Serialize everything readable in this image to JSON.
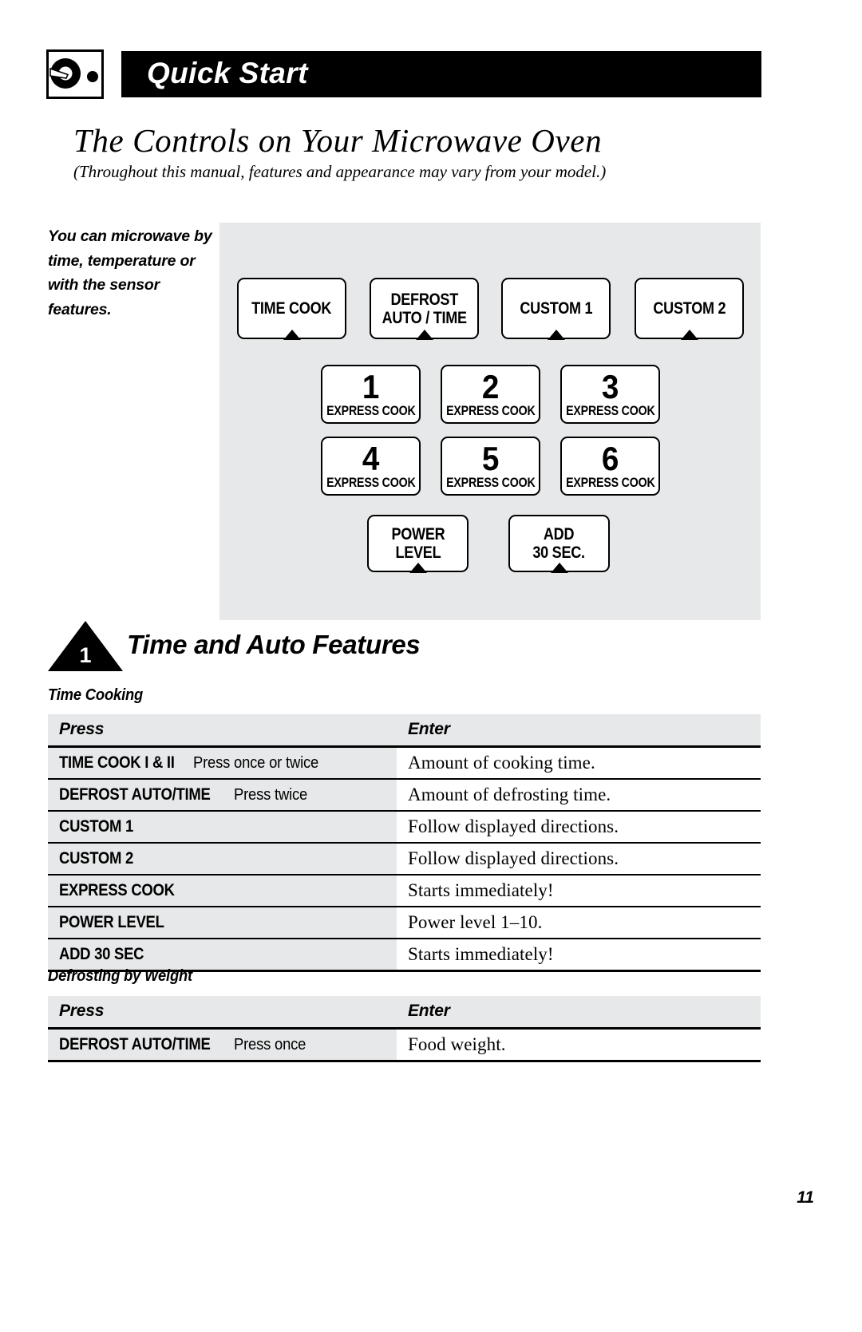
{
  "header": {
    "icon": "control-knob-icon",
    "banner_title": "Quick Start"
  },
  "section": {
    "title": "The Controls on Your Microwave Oven",
    "subtitle": "(Throughout this manual, features and appearance may vary from your model.)"
  },
  "sidebar": {
    "blurb": "You can microwave by time, temperature or with the sensor features."
  },
  "control_panel": {
    "background_color": "#e7e8e9",
    "rows": [
      {
        "buttons": [
          {
            "label": "TIME COOK",
            "marker": "triangle-up"
          },
          {
            "label": "DEFROST\nAUTO / TIME",
            "marker": "triangle-up"
          },
          {
            "label": "CUSTOM 1",
            "marker": "triangle-up"
          },
          {
            "label": "CUSTOM 2",
            "marker": "triangle-up"
          }
        ]
      },
      {
        "buttons": [
          {
            "number": "1",
            "sub": "EXPRESS COOK"
          },
          {
            "number": "2",
            "sub": "EXPRESS COOK"
          },
          {
            "number": "3",
            "sub": "EXPRESS COOK"
          }
        ]
      },
      {
        "buttons": [
          {
            "number": "4",
            "sub": "EXPRESS COOK"
          },
          {
            "number": "5",
            "sub": "EXPRESS COOK"
          },
          {
            "number": "6",
            "sub": "EXPRESS COOK"
          }
        ]
      },
      {
        "buttons": [
          {
            "label": "POWER\nLEVEL",
            "marker": "triangle-up"
          },
          {
            "label": "ADD\n30 SEC.",
            "marker": "triangle-up"
          }
        ]
      }
    ]
  },
  "step": {
    "number": "1",
    "title": "Time and Auto Features"
  },
  "tables": [
    {
      "caption": "Time Cooking",
      "headers": [
        "Press",
        "Enter"
      ],
      "rows": [
        {
          "press": "TIME COOK I & II",
          "press_note": "Press once or twice",
          "enter": "Amount of cooking time."
        },
        {
          "press": "DEFROST AUTO/TIME",
          "press_note": "Press twice",
          "enter": "Amount of defrosting time."
        },
        {
          "press": "CUSTOM 1",
          "press_note": "",
          "enter": "Follow displayed directions."
        },
        {
          "press": "CUSTOM 2",
          "press_note": "",
          "enter": "Follow displayed directions."
        },
        {
          "press": "EXPRESS COOK",
          "press_note": "",
          "enter": "Starts immediately!"
        },
        {
          "press": "POWER LEVEL",
          "press_note": "",
          "enter": "Power level 1–10."
        },
        {
          "press": "ADD 30 SEC",
          "press_note": "",
          "enter": "Starts immediately!"
        }
      ]
    },
    {
      "caption": "Defrosting by Weight",
      "headers": [
        "Press",
        "Enter"
      ],
      "rows": [
        {
          "press": "DEFROST AUTO/TIME",
          "press_note": "Press once",
          "enter": "Food weight."
        }
      ]
    }
  ],
  "footer": {
    "page_number": "11"
  }
}
